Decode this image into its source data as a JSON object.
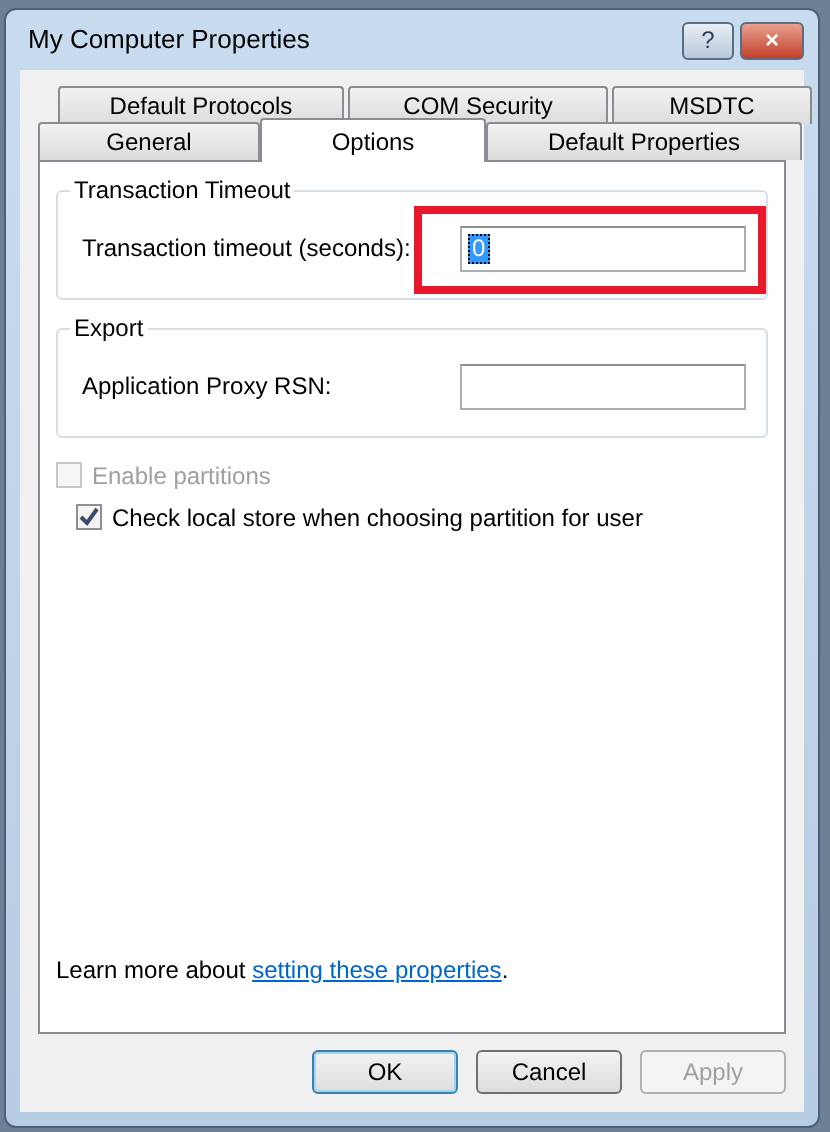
{
  "window": {
    "title": "My Computer Properties",
    "title_buttons": [
      "?",
      "×"
    ]
  },
  "tab_rows": [
    [
      {
        "label": "Default Protocols",
        "selected": false
      },
      {
        "label": "COM Security",
        "selected": false
      },
      {
        "label": "MSDTC",
        "selected": false
      }
    ],
    [
      {
        "label": "General",
        "selected": false
      },
      {
        "label": "Options",
        "selected": true
      },
      {
        "label": "Default Properties",
        "selected": false
      }
    ]
  ],
  "groups": [
    {
      "title": "Transaction Timeout",
      "label": "Transaction timeout (seconds):",
      "value": "0",
      "value_selected": true,
      "highlighted": true
    },
    {
      "title": "Export",
      "label": "Application Proxy RSN:",
      "highlighted": false
    }
  ],
  "checkboxes": [
    {
      "label": "Enable partitions",
      "checked": false,
      "disabled": true
    },
    {
      "label": "Check local store when choosing partition for user",
      "checked": true,
      "disabled": false
    }
  ],
  "footer": {
    "text": "Learn more about ",
    "link": "setting these properties",
    "after": "."
  },
  "buttons": [
    {
      "label": "OK",
      "disabled": false,
      "default": true
    },
    {
      "label": "Cancel",
      "disabled": false,
      "default": false
    },
    {
      "label": "Apply",
      "disabled": true,
      "default": false
    }
  ]
}
